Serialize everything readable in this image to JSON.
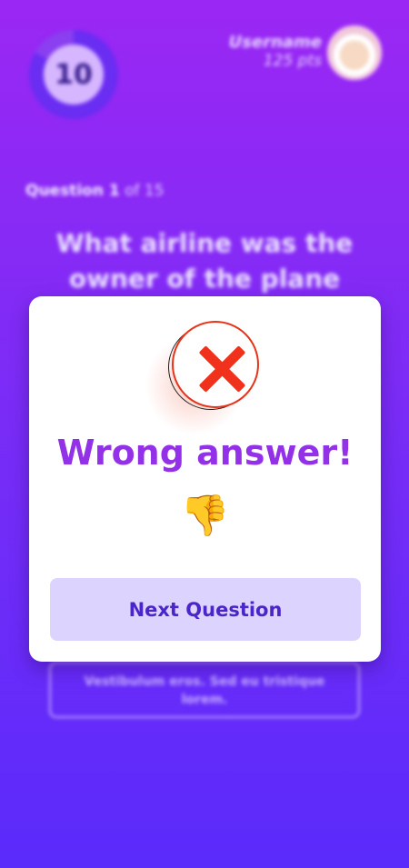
{
  "header": {
    "timer_value": "10",
    "username": "Username",
    "points": "125 pts"
  },
  "question": {
    "number_label": "Question 1",
    "total_label": "of 15",
    "text": "What airline was the owner of the plane"
  },
  "answer_option": {
    "text": "Vestibulum eros. Sed eu tristique lorem."
  },
  "modal": {
    "title": "Wrong answer!",
    "emoji": "👎",
    "next_button_label": "Next Question"
  },
  "icons": {
    "status": "cross-icon",
    "reaction": "thumbs-down-icon",
    "avatar": "user-avatar"
  },
  "colors": {
    "background_top": "#9b27f4",
    "background_bottom": "#5a2bfb",
    "title": "#9331e8",
    "error": "#f0321c",
    "button_bg": "#ddd3ff",
    "button_text": "#4a25c9"
  }
}
